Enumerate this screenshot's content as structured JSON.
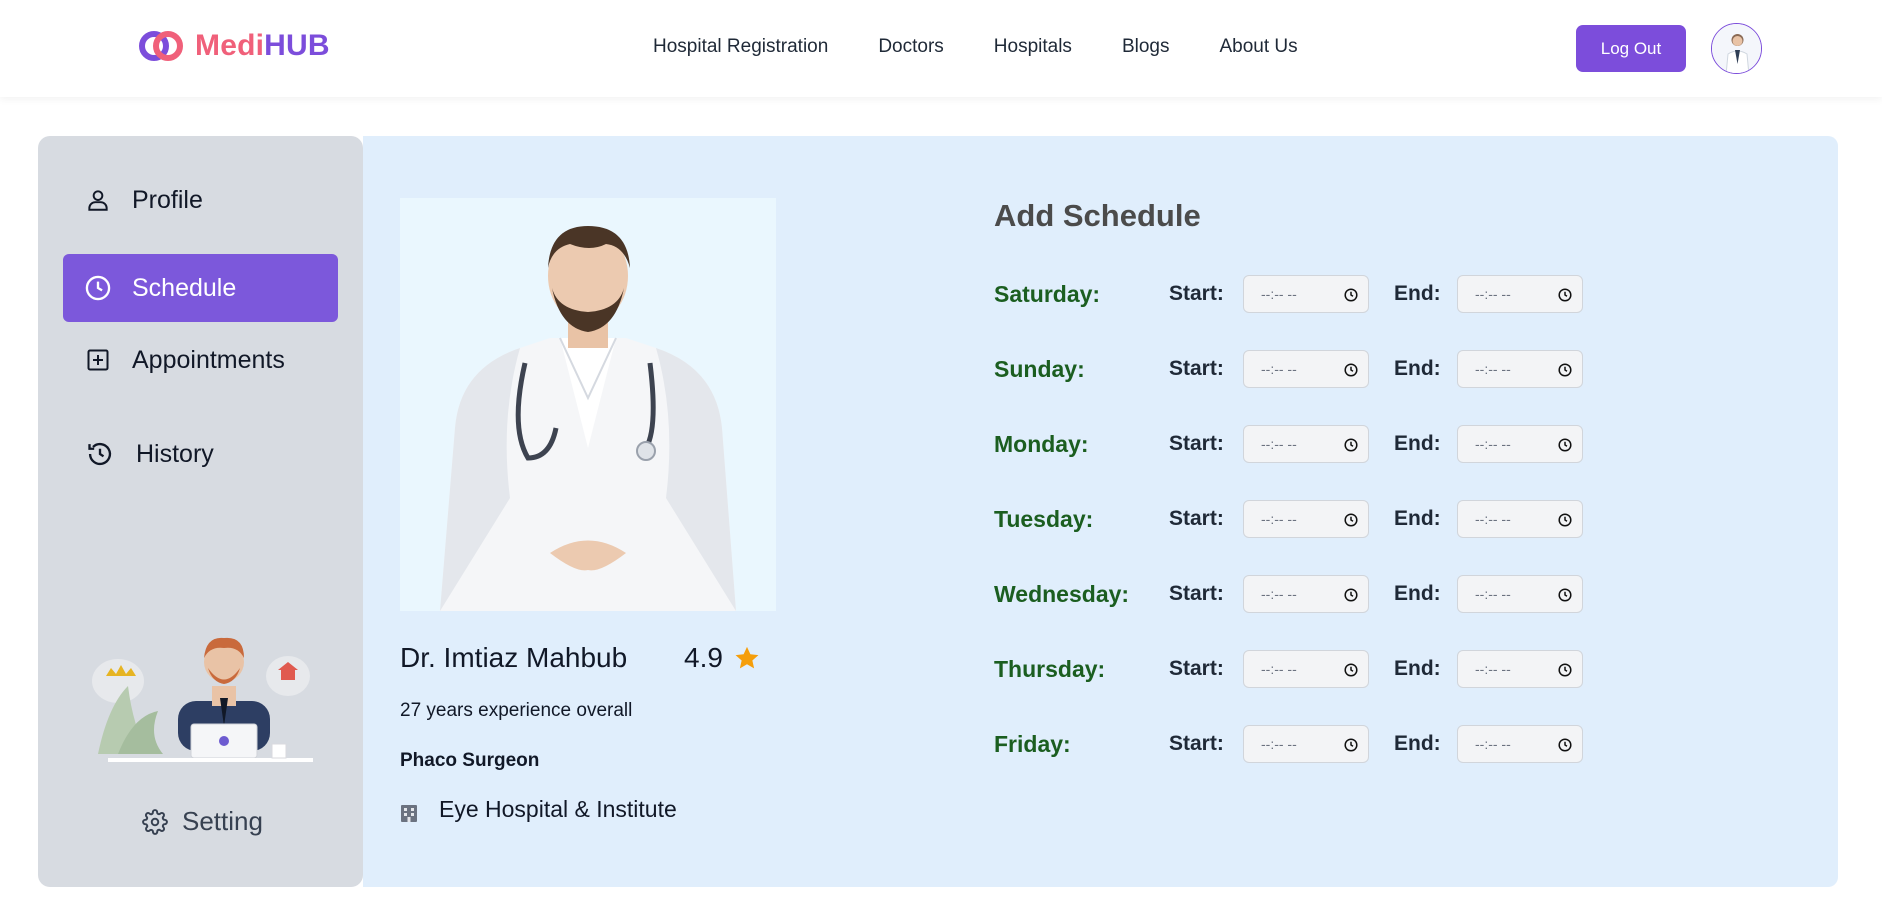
{
  "header": {
    "logo": {
      "part1": "Medi",
      "part2": "HUB"
    },
    "nav": [
      "Hospital Registration",
      "Doctors",
      "Hospitals",
      "Blogs",
      "About Us"
    ],
    "logout_label": "Log Out"
  },
  "sidebar": {
    "items": [
      {
        "label": "Profile",
        "icon": "user-icon",
        "active": false
      },
      {
        "label": "Schedule",
        "icon": "clock-icon",
        "active": true
      },
      {
        "label": "Appointments",
        "icon": "plus-square-icon",
        "active": false
      },
      {
        "label": "History",
        "icon": "history-icon",
        "active": false
      }
    ],
    "setting_label": "Setting"
  },
  "profile": {
    "name": "Dr. Imtiaz Mahbub",
    "rating": "4.9",
    "experience": "27 years experience overall",
    "specialty": "Phaco Surgeon",
    "hospital": "Eye Hospital & Institute"
  },
  "schedule": {
    "title": "Add Schedule",
    "start_label": "Start:",
    "end_label": "End:",
    "time_placeholder": "--:-- --",
    "days": [
      "Saturday:",
      "Sunday:",
      "Monday:",
      "Tuesday:",
      "Wednesday:",
      "Thursday:",
      "Friday:"
    ]
  },
  "colors": {
    "brand_purple": "#7c4ddb",
    "brand_pink": "#f0607a",
    "day_green": "#1b5e20",
    "panel_bg": "#e0eefc",
    "sidebar_bg": "#d7dbe1",
    "star": "#f59e0b"
  }
}
